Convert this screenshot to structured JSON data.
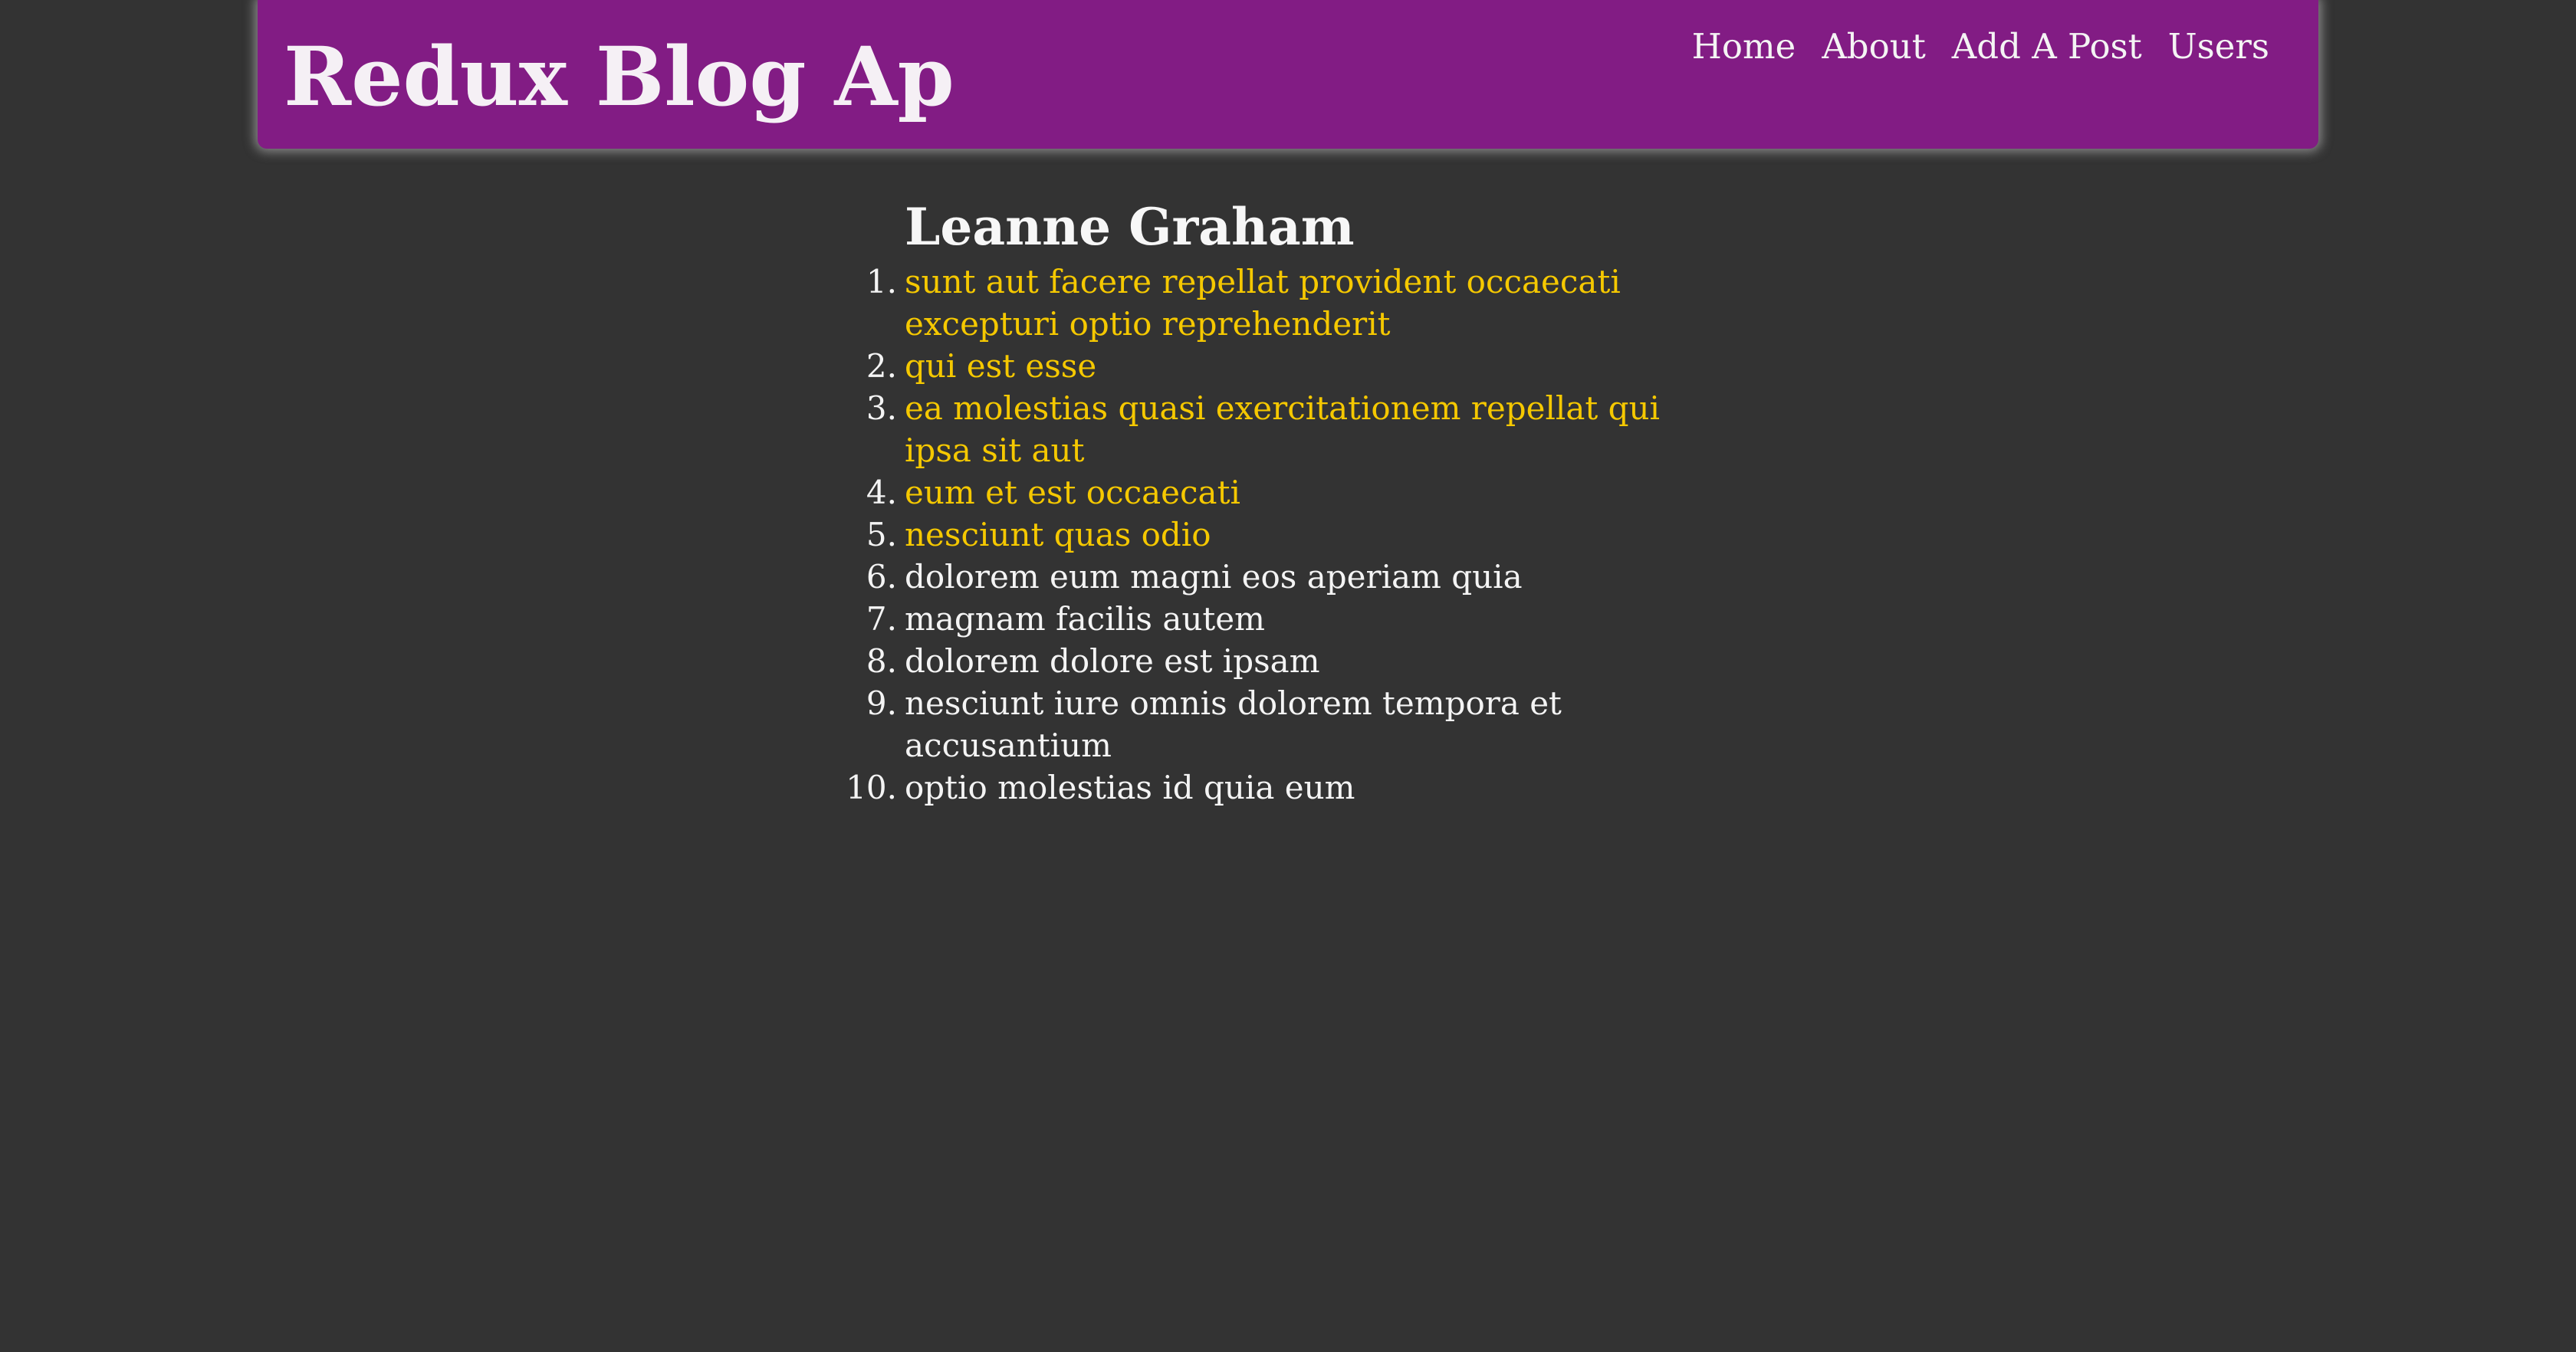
{
  "header": {
    "title": "Redux Blog Ap",
    "background_color": "#821c84"
  },
  "nav": {
    "items": [
      "Home",
      "About",
      "Add A Post",
      "Users"
    ]
  },
  "user": {
    "name": "Leanne Graham"
  },
  "posts": [
    {
      "num": "1.",
      "title": "sunt aut facere repellat provident occaecati excepturi optio reprehenderit",
      "color": "#f5c800"
    },
    {
      "num": "2.",
      "title": "qui est esse",
      "color": "#f5c800"
    },
    {
      "num": "3.",
      "title": "ea molestias quasi exercitationem repellat qui ipsa sit aut",
      "color": "#f5c800"
    },
    {
      "num": "4.",
      "title": "eum et est occaecati",
      "color": "#f5c800"
    },
    {
      "num": "5.",
      "title": "nesciunt quas odio",
      "color": "#f5c800"
    },
    {
      "num": "6.",
      "title": "dolorem eum magni eos aperiam quia",
      "color": "#f4f4f4"
    },
    {
      "num": "7.",
      "title": "magnam facilis autem",
      "color": "#f4f4f4"
    },
    {
      "num": "8.",
      "title": "dolorem dolore est ipsam",
      "color": "#f4f4f4"
    },
    {
      "num": "9.",
      "title": "nesciunt iure omnis dolorem tempora et accusantium",
      "color": "#f4f4f4"
    },
    {
      "num": "10.",
      "title": "optio molestias id quia eum",
      "color": "#f4f4f4"
    }
  ],
  "colors": {
    "page_background": "#333333",
    "link_highlight": "#f5c800",
    "text": "#f4f4f4"
  }
}
